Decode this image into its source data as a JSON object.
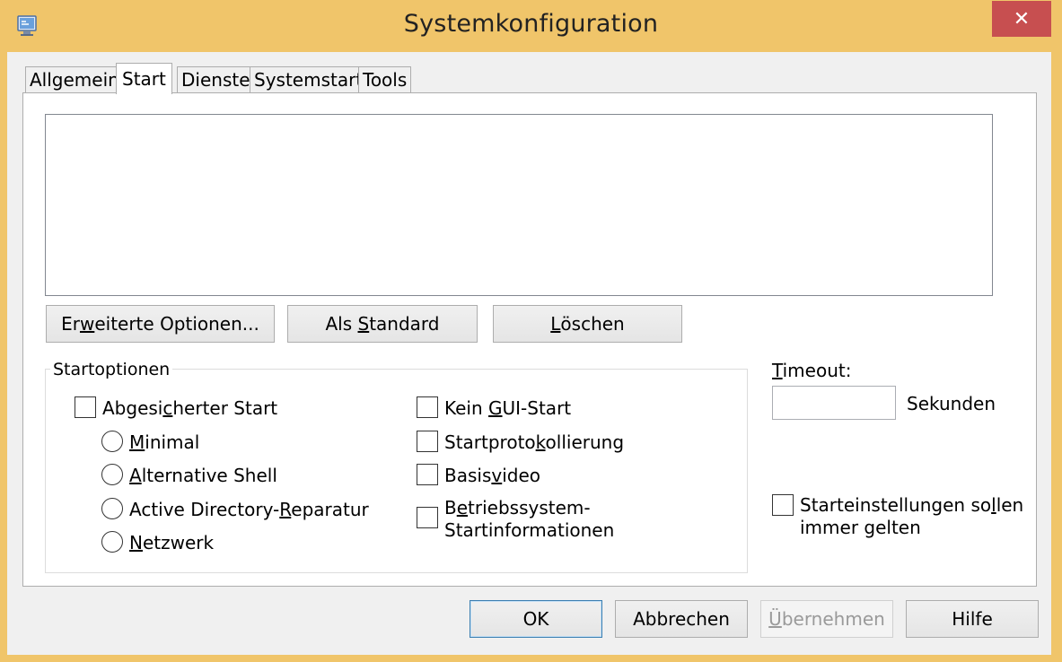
{
  "window": {
    "title": "Systemkonfiguration",
    "close_glyph": "✕"
  },
  "tabs": [
    {
      "label": "Allgemein"
    },
    {
      "label": "Start"
    },
    {
      "label": "Dienste"
    },
    {
      "label": "Systemstart"
    },
    {
      "label": "Tools"
    }
  ],
  "boot_buttons": {
    "advanced": {
      "pre": "Er",
      "key": "w",
      "post": "eiterte Optionen..."
    },
    "set_default": {
      "pre": "Als ",
      "key": "S",
      "post": "tandard"
    },
    "delete": {
      "pre": "",
      "key": "L",
      "post": "öschen"
    }
  },
  "startoptions": {
    "group_label": "Startoptionen",
    "safe_boot": {
      "pre": "Abgesi",
      "key": "c",
      "post": "herter Start"
    },
    "minimal": {
      "pre": "",
      "key": "M",
      "post": "inimal"
    },
    "alt_shell": {
      "pre": "",
      "key": "A",
      "post": "lternative Shell"
    },
    "ad_repair": {
      "pre": "Active Directory-",
      "key": "R",
      "post": "eparatur"
    },
    "network": {
      "pre": "",
      "key": "N",
      "post": "etzwerk"
    },
    "no_gui": {
      "pre": "Kein ",
      "key": "G",
      "post": "UI-Start"
    },
    "boot_log": {
      "pre": "Startproto",
      "key": "k",
      "post": "ollierung"
    },
    "base_video": {
      "pre": "Basis",
      "key": "v",
      "post": "ideo"
    },
    "os_info": {
      "pre": "B",
      "key": "e",
      "post": "triebssystem-",
      "line2": "Startinformationen"
    }
  },
  "timeout": {
    "label_key": "T",
    "label_rest": "imeout:",
    "value": "",
    "unit": "Sekunden"
  },
  "permanent": {
    "pre": "Starteinstellungen so",
    "key": "l",
    "post": "len",
    "line2": "immer gelten"
  },
  "dialog_buttons": {
    "ok": "OK",
    "cancel": "Abbrechen",
    "apply_key": "Ü",
    "apply_rest": "bernehmen",
    "help": "Hilfe"
  },
  "colors": {
    "frame": "#f0c56a",
    "close": "#c74f50"
  }
}
